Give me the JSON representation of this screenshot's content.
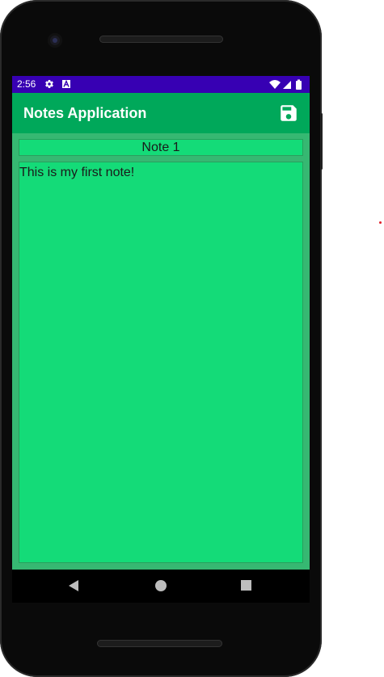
{
  "status_bar": {
    "time": "2:56",
    "background": "#3700b3",
    "icons": [
      "gear-icon",
      "a-notification-icon",
      "wifi-icon",
      "signal-icon",
      "battery-icon"
    ]
  },
  "app_bar": {
    "title": "Notes Application",
    "background": "#00a85a",
    "action_icon": "save-icon"
  },
  "note": {
    "title": "Note 1",
    "body": "This is my first note!",
    "field_color": "#14db78",
    "background": "#36b872"
  },
  "nav_bar": {
    "buttons": [
      "back-icon",
      "home-icon",
      "recents-icon"
    ]
  }
}
